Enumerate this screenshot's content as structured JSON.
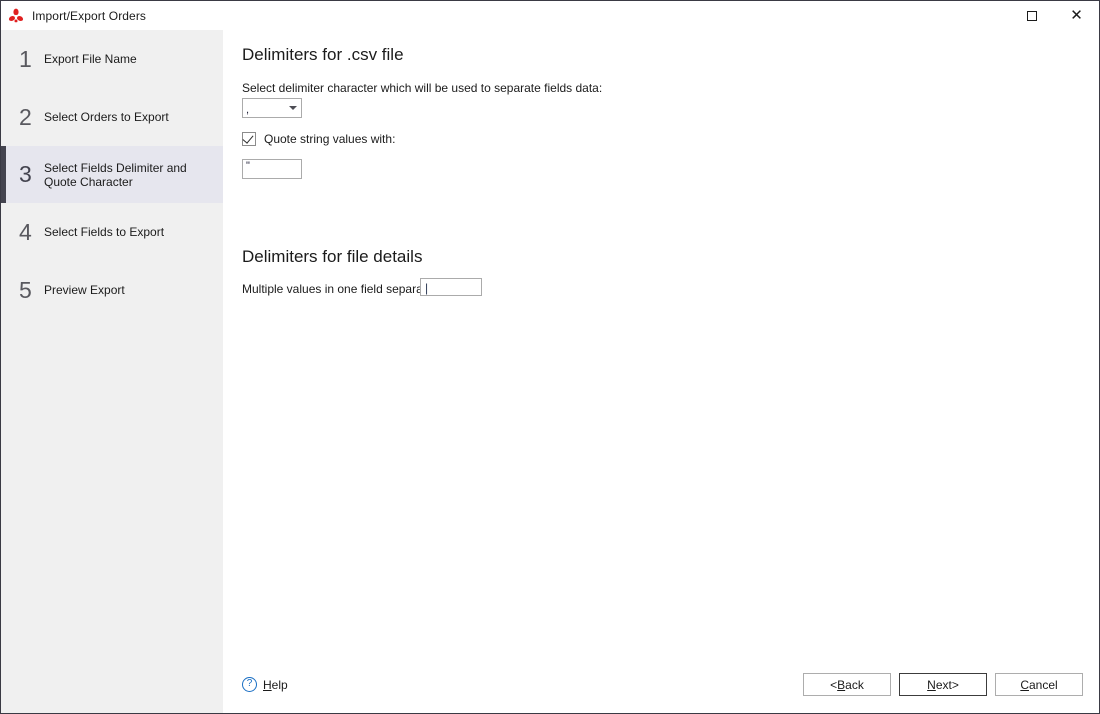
{
  "window": {
    "title": "Import/Export Orders",
    "icon": "app-propeller-icon",
    "icon_color": "#e02020",
    "maximize_label": "Maximize",
    "close_label": "Close"
  },
  "sidebar": {
    "active_step": 3,
    "accent_color": "#44444f",
    "active_background": "#e6e6ee",
    "background": "#f0f0f0",
    "steps": [
      {
        "number": "1",
        "label": "Export File Name"
      },
      {
        "number": "2",
        "label": "Select Orders to Export"
      },
      {
        "number": "3",
        "label": "Select Fields Delimiter and Quote Character"
      },
      {
        "number": "4",
        "label": "Select Fields to Export"
      },
      {
        "number": "5",
        "label": "Preview Export"
      }
    ]
  },
  "main": {
    "csv_section": {
      "heading": "Delimiters for .csv file",
      "delimiter_label": "Select delimiter character which will be used to separate fields data:",
      "delimiter_value": ",",
      "quote_checkbox_label": "Quote string values with:",
      "quote_checked": true,
      "quote_value": "\""
    },
    "details_section": {
      "heading": "Delimiters for file details",
      "multivalue_label": "Multiple values in one field separator",
      "multivalue_value": "|"
    }
  },
  "footer": {
    "help_label": "Help",
    "help_accel": "H",
    "help_rest": "elp",
    "help_icon": "question-mark-icon",
    "buttons": {
      "back": {
        "prefix": "< ",
        "accel": "B",
        "rest": "ack"
      },
      "next": {
        "accel": "N",
        "rest": "ext",
        "suffix": " >"
      },
      "cancel": {
        "accel": "C",
        "rest": "ancel"
      }
    }
  }
}
